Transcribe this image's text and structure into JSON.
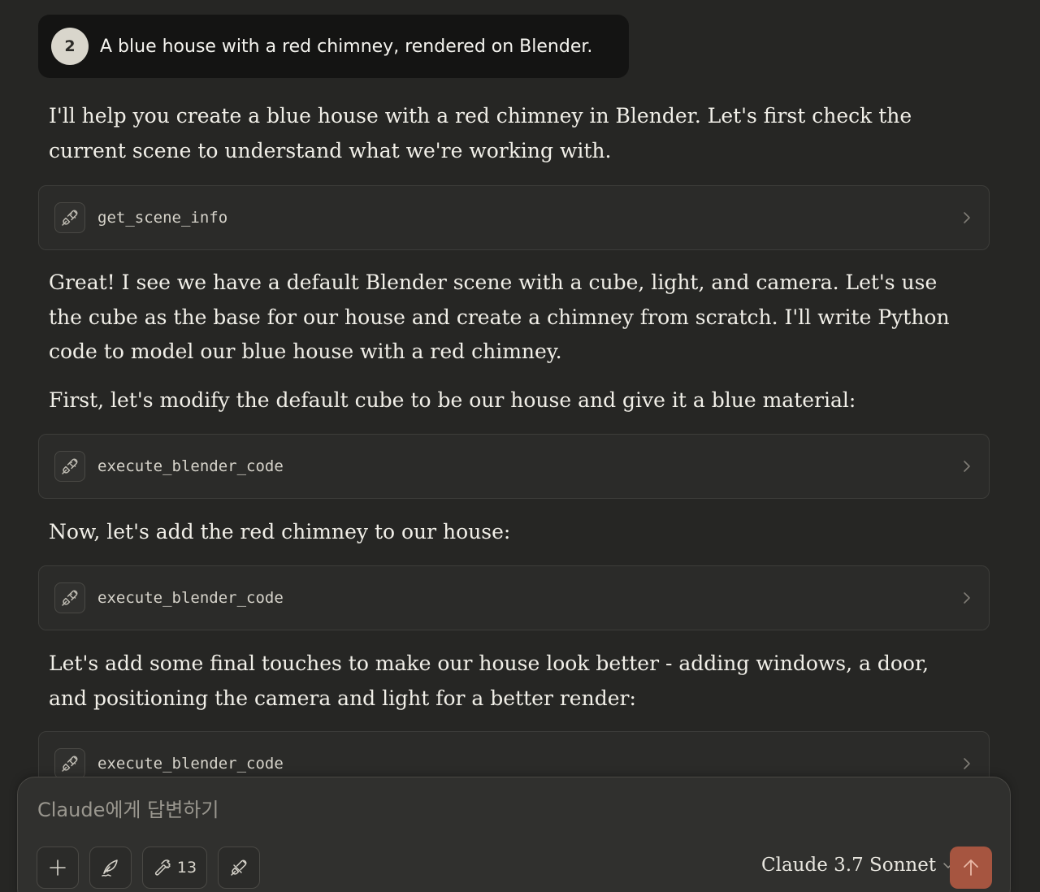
{
  "user_message": {
    "avatar_initial": "2",
    "text": "A blue house with a red chimney, rendered on Blender."
  },
  "conversation": {
    "para1": "I'll help you create a blue house with a red chimney in Blender. Let's first check the current scene to understand what we're working with.",
    "para2": "Great! I see we have a default Blender scene with a cube, light, and camera. Let's use the cube as the base for our house and create a chimney from scratch. I'll write Python code to model our blue house with a red chimney.",
    "para3": "First, let's modify the default cube to be our house and give it a blue material:",
    "para4": "Now, let's add the red chimney to our house:",
    "para5": "Let's add some final touches to make our house look better - adding windows, a door, and positioning the camera and light for a better render:"
  },
  "tool_calls": [
    {
      "name": "get_scene_info",
      "icon": "plug-icon"
    },
    {
      "name": "execute_blender_code",
      "icon": "plug-icon"
    },
    {
      "name": "execute_blender_code",
      "icon": "plug-icon"
    },
    {
      "name": "execute_blender_code",
      "icon": "plug-icon"
    }
  ],
  "composer": {
    "placeholder": "Claude에게 답변하기",
    "tools_count": "13",
    "model_name": "Claude 3.7 Sonnet",
    "send_color": "#a65540"
  },
  "colors": {
    "background": "#262624",
    "user_bubble": "#141413",
    "tool_card": "#2b2b29",
    "accent": "#a65540"
  }
}
